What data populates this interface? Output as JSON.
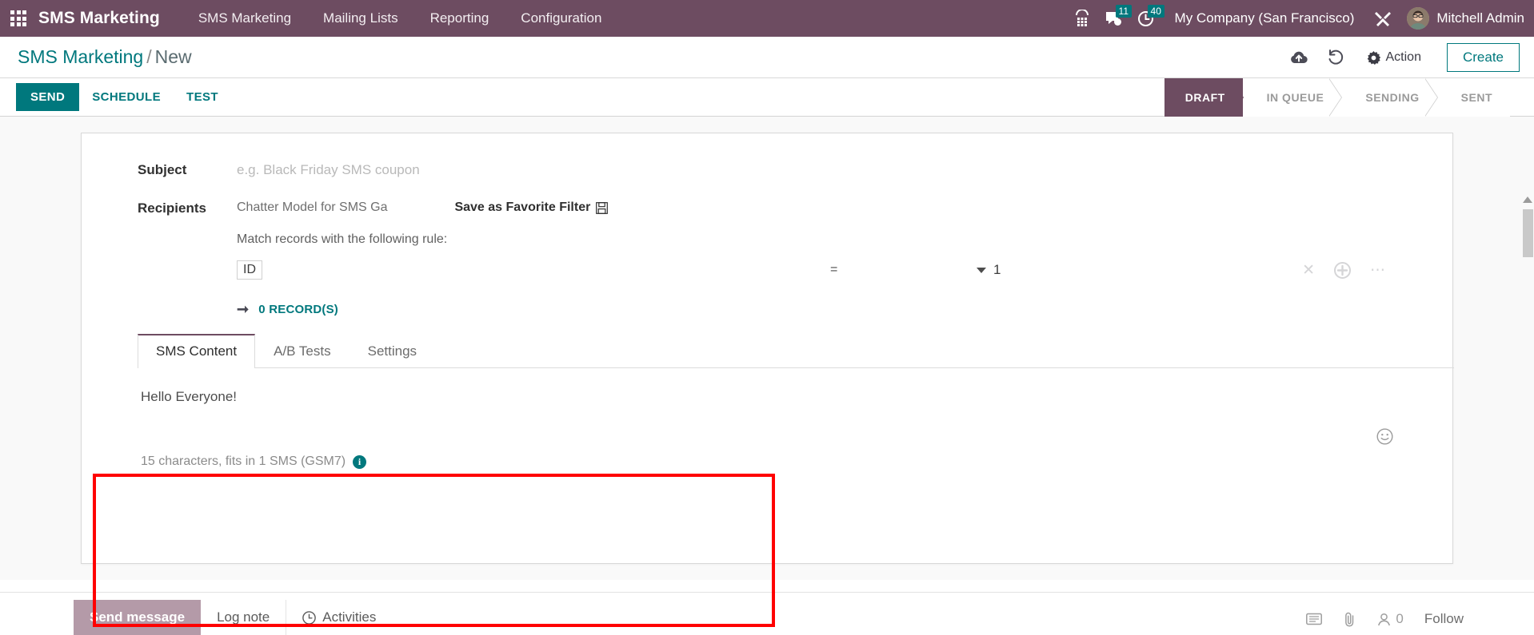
{
  "navbar": {
    "apps_icon": "apps-grid-icon",
    "brand": "SMS Marketing",
    "menu": [
      {
        "label": "SMS Marketing"
      },
      {
        "label": "Mailing Lists"
      },
      {
        "label": "Reporting"
      },
      {
        "label": "Configuration"
      }
    ],
    "voip_icon": "phone-dialpad-icon",
    "messages_icon": "chat-bubble-icon",
    "messages_count": "11",
    "activities_icon": "clock-icon",
    "activities_count": "40",
    "company": "My Company (San Francisco)",
    "debug_icon": "tools-icon",
    "user": "Mitchell Admin"
  },
  "control_panel": {
    "breadcrumb_root": "SMS Marketing",
    "breadcrumb_sep": "/",
    "breadcrumb_current": "New",
    "save_icon": "cloud-upload-icon",
    "discard_icon": "undo-icon",
    "action_icon": "gear-icon",
    "action_label": "Action",
    "create_label": "Create"
  },
  "statusbar": {
    "buttons": [
      {
        "label": "SEND",
        "style": "primary"
      },
      {
        "label": "SCHEDULE",
        "style": "link"
      },
      {
        "label": "TEST",
        "style": "link"
      }
    ],
    "stages": [
      {
        "label": "DRAFT",
        "active": true
      },
      {
        "label": "IN QUEUE",
        "active": false
      },
      {
        "label": "SENDING",
        "active": false
      },
      {
        "label": "SENT",
        "active": false
      }
    ]
  },
  "form": {
    "subject_label": "Subject",
    "subject_value": "",
    "subject_placeholder": "e.g. Black Friday SMS coupon",
    "recipients_label": "Recipients",
    "recipients_model": "Chatter Model for SMS Ga",
    "save_filter_label": "Save as Favorite Filter",
    "save_filter_icon": "floppy-disk-icon",
    "rule_caption": "Match records with the following rule:",
    "domain": {
      "field": "ID",
      "operator": "=",
      "value": "1",
      "delete_icon": "close-x-icon",
      "add_icon": "circle-plus-icon",
      "more_icon": "ellipsis-icon"
    },
    "records_arrow_icon": "arrow-right-icon",
    "records_label": "0 RECORD(S)"
  },
  "notebook": {
    "tabs": [
      {
        "label": "SMS Content",
        "active": true
      },
      {
        "label": "A/B Tests",
        "active": false
      },
      {
        "label": "Settings",
        "active": false
      }
    ],
    "sms_body": "Hello Everyone!",
    "char_count": "15 characters, fits in 1 SMS (GSM7)",
    "info_icon": "info-circle-icon",
    "info_glyph": "i",
    "emoji_icon": "smiley-icon"
  },
  "chatter": {
    "send_message": "Send message",
    "log_note": "Log note",
    "activities": "Activities",
    "activities_icon": "clock-plus-icon",
    "attachment_icon": "paperclip-icon",
    "note_icon": "note-icon",
    "followers_icon": "user-icon",
    "followers_count": "0",
    "follow_label": "Follow"
  },
  "colors": {
    "brand_purple": "#6d4c61",
    "accent_teal": "#00787d",
    "highlight_red": "#ff0000"
  }
}
